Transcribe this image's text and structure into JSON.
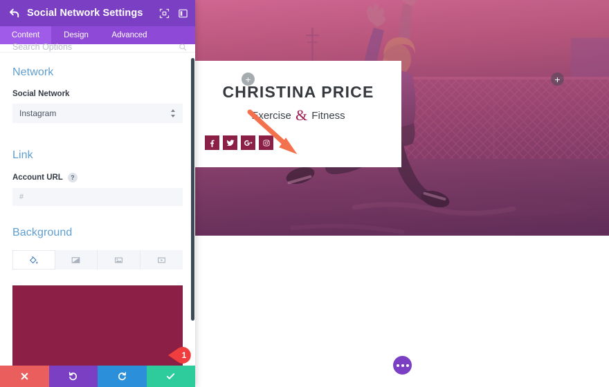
{
  "panel": {
    "title": "Social Network Settings",
    "back_icon": "back-arrow-icon",
    "header_tools": [
      {
        "name": "expand-icon",
        "label": "Expand"
      },
      {
        "name": "layout-toggle-icon",
        "label": "Layout"
      }
    ],
    "tabs": [
      {
        "label": "Content",
        "active": true
      },
      {
        "label": "Design",
        "active": false
      },
      {
        "label": "Advanced",
        "active": false
      }
    ],
    "search": {
      "placeholder": "Search Options",
      "value": "",
      "icon": "search-icon"
    }
  },
  "network_section": {
    "title": "Network",
    "social_network_label": "Social Network",
    "social_network_value": "Instagram"
  },
  "link_section": {
    "title": "Link",
    "account_url_label": "Account URL",
    "help_glyph": "?",
    "account_url_value": "",
    "account_url_placeholder": "#"
  },
  "background_section": {
    "title": "Background",
    "tabs": [
      {
        "name": "background-color-tab",
        "icon": "paint-bucket-icon",
        "active": true
      },
      {
        "name": "background-gradient-tab",
        "icon": "gradient-icon",
        "active": false
      },
      {
        "name": "background-image-tab",
        "icon": "image-icon",
        "active": false
      },
      {
        "name": "background-video-tab",
        "icon": "video-icon",
        "active": false
      }
    ],
    "swatch_color": "#8C1F45"
  },
  "marker": {
    "number": "1",
    "color": "#F03E3E"
  },
  "action_bar": [
    {
      "name": "close-button",
      "icon": "close-icon",
      "color": "#EB5E5E"
    },
    {
      "name": "undo-button",
      "icon": "undo-icon",
      "color": "#7B3FC4"
    },
    {
      "name": "redo-button",
      "icon": "redo-icon",
      "color": "#2B90D9"
    },
    {
      "name": "save-button",
      "icon": "check-icon",
      "color": "#2ECC9C"
    }
  ],
  "canvas": {
    "add_left_label": "+",
    "add_right_label": "+",
    "card": {
      "title": "CHRISTINA PRICE",
      "subtitle_before": "Exercise ",
      "subtitle_amp": "&",
      "subtitle_after": " Fitness",
      "socials": [
        {
          "name": "facebook-icon",
          "label": "Facebook"
        },
        {
          "name": "twitter-icon",
          "label": "Twitter"
        },
        {
          "name": "google-plus-icon",
          "label": "Google Plus"
        },
        {
          "name": "instagram-icon",
          "label": "Instagram"
        }
      ]
    },
    "annotation_arrow_color": "#F4714E",
    "more_button": {
      "name": "more-options-button",
      "icon": "ellipsis-icon",
      "color": "#7B3FC4"
    }
  },
  "colors": {
    "header_purple": "#7B3FC4",
    "tab_purple": "#8E49D6",
    "tab_active_purple": "#A05BE8",
    "section_heading_blue": "#5f9ed0",
    "brand_maroon": "#8C1F45"
  }
}
